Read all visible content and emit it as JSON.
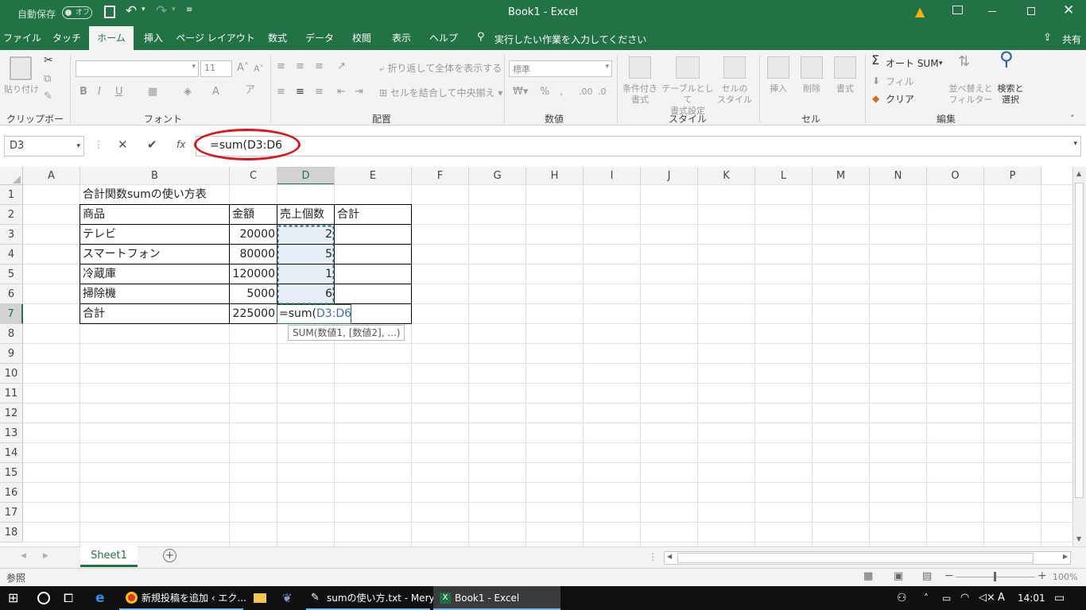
{
  "titlebar": {
    "autosave_label": "自動保存",
    "autosave_state": "オフ",
    "title": "Book1 - Excel"
  },
  "tabs": [
    "ファイル",
    "タッチ",
    "ホーム",
    "挿入",
    "ページ レイアウト",
    "数式",
    "データ",
    "校閲",
    "表示",
    "ヘルプ"
  ],
  "active_tab": "ホーム",
  "tell_me": "実行したい作業を入力してください",
  "share_label": "共有",
  "ribbon": {
    "clipboard": {
      "paste": "貼り付け",
      "label": "クリップボード"
    },
    "font": {
      "size": "11",
      "label": "フォント"
    },
    "alignment": {
      "wrap": "折り返して全体を表示する",
      "merge": "セルを結合して中央揃え",
      "label": "配置"
    },
    "number": {
      "format": "標準",
      "label": "数値"
    },
    "styles": {
      "conditional": "条件付き\n書式",
      "table": "テーブルとして\n書式設定",
      "cell": "セルの\nスタイル",
      "label": "スタイル"
    },
    "cells": {
      "insert": "挿入",
      "delete": "削除",
      "format": "書式",
      "label": "セル"
    },
    "editing": {
      "autosum": "オート SUM",
      "fill": "フィル",
      "clear": "クリア",
      "sort": "並べ替えと\nフィルター",
      "find": "検索と\n選択",
      "label": "編集"
    }
  },
  "formula_bar": {
    "name_box": "D3",
    "fx": "fx",
    "formula": "=sum(D3:D6"
  },
  "columns": [
    "A",
    "B",
    "C",
    "D",
    "E",
    "F",
    "G",
    "H",
    "I",
    "J",
    "K",
    "L",
    "M",
    "N",
    "O",
    "P"
  ],
  "rows": [
    "1",
    "2",
    "3",
    "4",
    "5",
    "6",
    "7",
    "8",
    "9",
    "10",
    "11",
    "12",
    "13",
    "14",
    "15",
    "16",
    "17",
    "18"
  ],
  "cells": {
    "B1": "合計関数sumの使い方表",
    "B2": "商品",
    "C2": "金額",
    "D2": "売上個数",
    "E2": "合計",
    "B3": "テレビ",
    "C3": "20000",
    "D3": "2",
    "B4": "スマートフォン",
    "C4": "80000",
    "D4": "5",
    "B5": "冷蔵庫",
    "C5": "120000",
    "D5": "1",
    "B6": "掃除機",
    "C6": "5000",
    "D6": "6",
    "B7": "合計",
    "C7": "225000",
    "D7_prefix": "=sum(",
    "D7_ref": "D3:D6"
  },
  "tooltip": "SUM(数値1, [数値2], ...)",
  "sheet_tab": "Sheet1",
  "status": {
    "mode": "参照",
    "zoom": "100%"
  },
  "taskbar": {
    "items": [
      "新規投稿を追加 ‹ エク...",
      "sumの使い方.txt - Mery",
      "Book1 - Excel"
    ],
    "ime": "A",
    "time": "14:01"
  },
  "colors": {
    "excel_green": "#217346",
    "formula_ref": "#3a6fb0",
    "annotation_circle": "#e0141e",
    "selection_fill": "#e8eef8"
  }
}
